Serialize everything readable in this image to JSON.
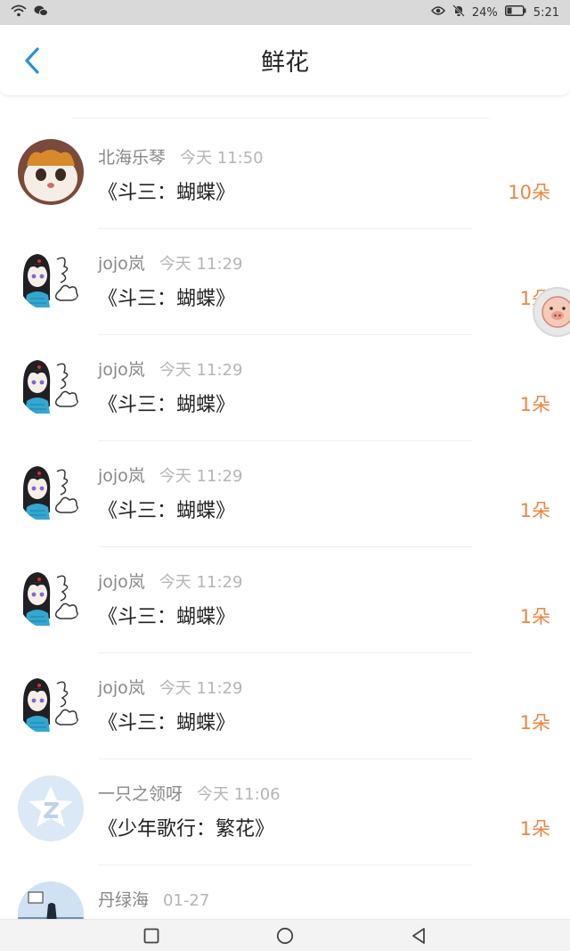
{
  "status": {
    "battery": "24%",
    "time": "5:21"
  },
  "header": {
    "title": "鲜花"
  },
  "rows": [
    {
      "name": "北海乐琴",
      "time": "今天 11:50",
      "work": "《斗三：蝴蝶》",
      "count": "10朵",
      "avatar": "cat"
    },
    {
      "name": "jojo岚",
      "time": "今天 11:29",
      "work": "《斗三：蝴蝶》",
      "count": "1朵",
      "avatar": "girl"
    },
    {
      "name": "jojo岚",
      "time": "今天 11:29",
      "work": "《斗三：蝴蝶》",
      "count": "1朵",
      "avatar": "girl"
    },
    {
      "name": "jojo岚",
      "time": "今天 11:29",
      "work": "《斗三：蝴蝶》",
      "count": "1朵",
      "avatar": "girl"
    },
    {
      "name": "jojo岚",
      "time": "今天 11:29",
      "work": "《斗三：蝴蝶》",
      "count": "1朵",
      "avatar": "girl"
    },
    {
      "name": "jojo岚",
      "time": "今天 11:29",
      "work": "《斗三：蝴蝶》",
      "count": "1朵",
      "avatar": "girl"
    },
    {
      "name": "一只之领呀",
      "time": "今天 11:06",
      "work": "《少年歌行：繁花》",
      "count": "1朵",
      "avatar": "default"
    },
    {
      "name": "丹绿海",
      "time": "01-27",
      "work": "",
      "count": "",
      "avatar": "landscape"
    }
  ],
  "icons": {
    "back": "chevron-left-icon",
    "nav_recent": "square-icon",
    "nav_home": "circle-icon",
    "nav_back": "triangle-back-icon"
  },
  "colors": {
    "accent": "#2d8fdc",
    "flower_count": "#ee8540"
  }
}
